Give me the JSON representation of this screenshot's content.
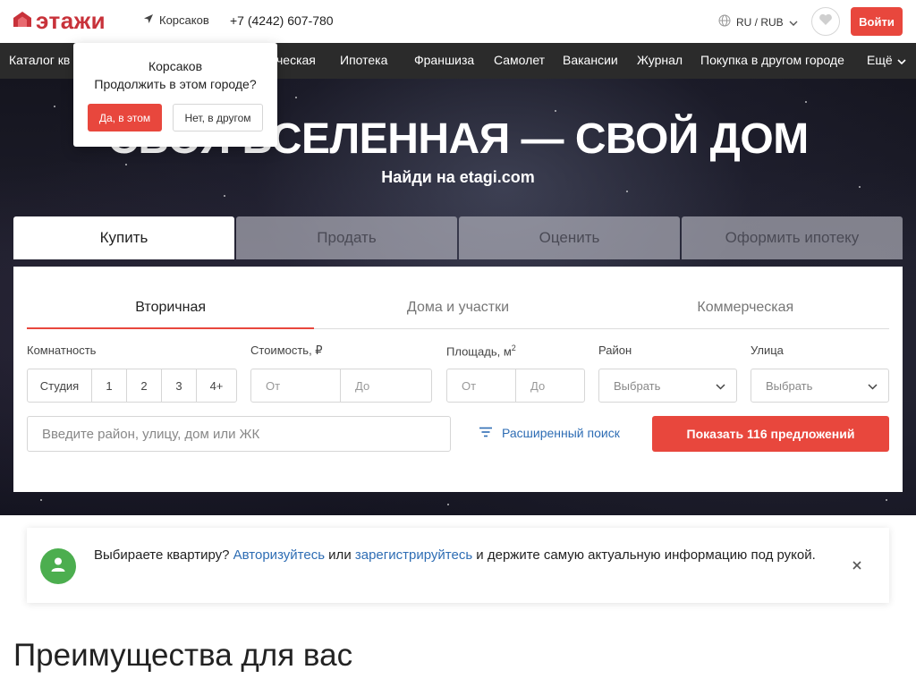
{
  "header": {
    "logo_text": "этажи",
    "city": "Корсаков",
    "phone": "+7 (4242) 607-780",
    "lang_currency": "RU / RUB",
    "login_label": "Войти"
  },
  "nav": {
    "items": [
      "Каталог кв",
      "ческая",
      "Ипотека",
      "Франшиза",
      "Самолет",
      "Вакансии",
      "Журнал",
      "Покупка в другом городе",
      "Ещё"
    ]
  },
  "popup": {
    "city": "Корсаков",
    "question": "Продолжить в этом городе?",
    "yes_label": "Да, в этом",
    "no_label": "Нет, в другом"
  },
  "hero": {
    "title": "СВОЯ ВСЕЛЕННАЯ — СВОЙ ДОМ",
    "subtitle": "Найди на etagi.com"
  },
  "tabs": [
    "Купить",
    "Продать",
    "Оценить",
    "Оформить ипотеку"
  ],
  "subtabs": [
    "Вторичная",
    "Дома и участки",
    "Коммерческая"
  ],
  "filters": {
    "rooms_label": "Комнатность",
    "rooms": [
      "Студия",
      "1",
      "2",
      "3",
      "4+"
    ],
    "price_label": "Стоимость, ₽",
    "price_from": "От",
    "price_to": "До",
    "area_label": "Площадь, м",
    "area_sup": "2",
    "area_from": "От",
    "area_to": "До",
    "district_label": "Район",
    "district_value": "Выбрать",
    "street_label": "Улица",
    "street_value": "Выбрать",
    "search_placeholder": "Введите район, улицу, дом или ЖК",
    "advanced_label": "Расширенный поиск",
    "show_label": "Показать 116 предложений"
  },
  "banner": {
    "text_1": "Выбираете квартиру? ",
    "link_login": "Авторизуйтесь",
    "text_2": " или ",
    "link_register": "зарегистрируйтесь",
    "text_3": " и держите самую актуальную информацию под рукой."
  },
  "section": {
    "title": "Преимущества для вас"
  },
  "colors": {
    "accent": "#e8473d",
    "logo": "#c8323a",
    "link": "#2e6db4",
    "nav_bg": "#2b2b2b",
    "avatar": "#4cae4f"
  },
  "icons": [
    "house-logo-icon",
    "location-arrow-icon",
    "globe-icon",
    "chevron-down-icon",
    "heart-icon",
    "filter-icon",
    "user-icon",
    "close-icon"
  ]
}
